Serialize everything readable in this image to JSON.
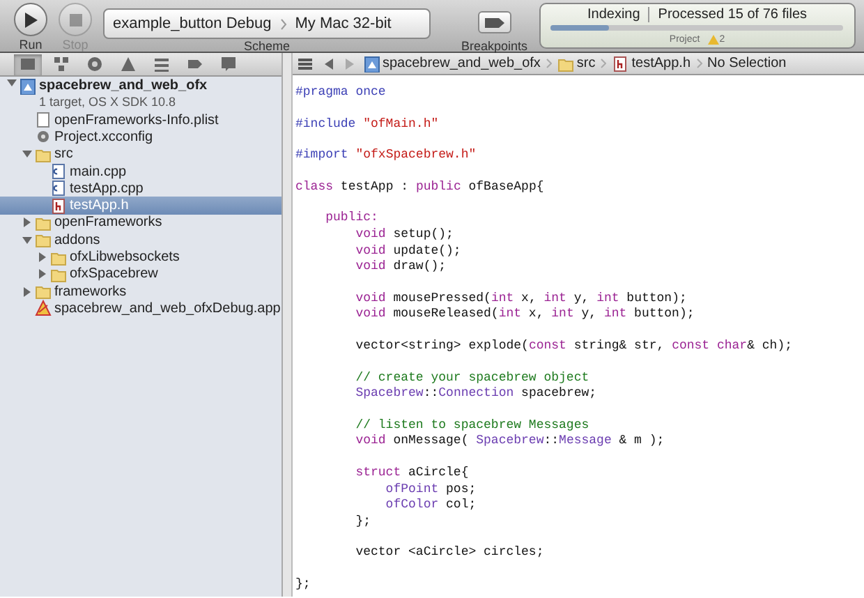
{
  "toolbar": {
    "run": {
      "label": "Run",
      "disabled": false
    },
    "stop": {
      "label": "Stop",
      "disabled": true
    },
    "scheme": {
      "target": "example_button Debug",
      "destination": "My Mac 32-bit",
      "label": "Scheme"
    },
    "breakpoints": {
      "label": "Breakpoints"
    },
    "activity": {
      "task": "Indexing",
      "status": "Processed 15 of 76 files",
      "level": 0.2,
      "scope": "Project",
      "warnings": "2"
    }
  },
  "navigator_tabs": [
    {
      "kind": "project",
      "selected": true
    },
    {
      "kind": "symbols",
      "selected": false
    },
    {
      "kind": "search",
      "selected": false
    },
    {
      "kind": "issues",
      "selected": false
    },
    {
      "kind": "debug",
      "selected": false
    },
    {
      "kind": "breakpoints",
      "selected": false
    },
    {
      "kind": "log",
      "selected": false
    }
  ],
  "jump_bar": [
    {
      "kind": "project",
      "label": "spacebrew_and_web_ofx"
    },
    {
      "kind": "folder",
      "label": "src"
    },
    {
      "kind": "header",
      "label": "testApp.h"
    },
    {
      "kind": "none",
      "label": "No Selection"
    }
  ],
  "tree": [
    {
      "kind": "project",
      "label": "spacebrew_and_web_ofx",
      "subtitle": "1 target, OS X SDK 10.8",
      "expanded": true,
      "selected": false,
      "children": [
        {
          "kind": "plist",
          "label": "openFrameworks-Info.plist",
          "selected": false
        },
        {
          "kind": "config",
          "label": "Project.xcconfig",
          "selected": false
        },
        {
          "kind": "folder",
          "label": "src",
          "expanded": true,
          "selected": false,
          "children": [
            {
              "kind": "cpp",
              "label": "main.cpp",
              "selected": false
            },
            {
              "kind": "cpp",
              "label": "testApp.cpp",
              "selected": false
            },
            {
              "kind": "header",
              "label": "testApp.h",
              "selected": true
            }
          ]
        },
        {
          "kind": "folder",
          "label": "openFrameworks",
          "expanded": false,
          "selected": false
        },
        {
          "kind": "folder",
          "label": "addons",
          "expanded": true,
          "selected": false,
          "children": [
            {
              "kind": "folder",
              "label": "ofxLibwebsockets",
              "expanded": false,
              "selected": false
            },
            {
              "kind": "folder",
              "label": "ofxSpacebrew",
              "expanded": false,
              "selected": false
            }
          ]
        },
        {
          "kind": "folder",
          "label": "frameworks",
          "expanded": false,
          "selected": false
        },
        {
          "kind": "app",
          "label": "spacebrew_and_web_ofxDebug.app",
          "selected": false
        }
      ]
    }
  ],
  "code_blocks": [
    [
      [
        {
          "kind": "pp",
          "text": "#pragma once"
        }
      ]
    ],
    [
      [
        {
          "kind": "pp",
          "text": "#include "
        },
        {
          "kind": "str",
          "text": "\"ofMain.h\""
        }
      ]
    ],
    [
      [
        {
          "kind": "pp",
          "text": "#import "
        },
        {
          "kind": "str",
          "text": "\"ofxSpacebrew.h\""
        }
      ]
    ],
    [
      [
        {
          "kind": "kw",
          "text": "class"
        },
        {
          "kind": "plain",
          "text": " testApp : "
        },
        {
          "kind": "kw",
          "text": "public"
        },
        {
          "kind": "plain",
          "text": " ofBaseApp{"
        }
      ]
    ],
    [
      [
        {
          "kind": "kw",
          "text": "    public:"
        }
      ],
      [
        {
          "kind": "kw",
          "text": "        void"
        },
        {
          "kind": "plain",
          "text": " setup();"
        }
      ],
      [
        {
          "kind": "kw",
          "text": "        void"
        },
        {
          "kind": "plain",
          "text": " update();"
        }
      ],
      [
        {
          "kind": "kw",
          "text": "        void"
        },
        {
          "kind": "plain",
          "text": " draw();"
        }
      ]
    ],
    [
      [
        {
          "kind": "kw",
          "text": "        void"
        },
        {
          "kind": "plain",
          "text": " mousePressed("
        },
        {
          "kind": "kw",
          "text": "int"
        },
        {
          "kind": "plain",
          "text": " x, "
        },
        {
          "kind": "kw",
          "text": "int"
        },
        {
          "kind": "plain",
          "text": " y, "
        },
        {
          "kind": "kw",
          "text": "int"
        },
        {
          "kind": "plain",
          "text": " button);"
        }
      ],
      [
        {
          "kind": "kw",
          "text": "        void"
        },
        {
          "kind": "plain",
          "text": " mouseReleased("
        },
        {
          "kind": "kw",
          "text": "int"
        },
        {
          "kind": "plain",
          "text": " x, "
        },
        {
          "kind": "kw",
          "text": "int"
        },
        {
          "kind": "plain",
          "text": " y, "
        },
        {
          "kind": "kw",
          "text": "int"
        },
        {
          "kind": "plain",
          "text": " button);"
        }
      ]
    ],
    [
      [
        {
          "kind": "plain",
          "text": "        vector<string> explode("
        },
        {
          "kind": "kw",
          "text": "const"
        },
        {
          "kind": "plain",
          "text": " string& str, "
        },
        {
          "kind": "kw",
          "text": "const char"
        },
        {
          "kind": "plain",
          "text": "& ch);"
        }
      ]
    ],
    [
      [
        {
          "kind": "cmt",
          "text": "        // create your spacebrew object"
        }
      ],
      [
        {
          "kind": "type",
          "text": "        Spacebrew"
        },
        {
          "kind": "plain",
          "text": "::"
        },
        {
          "kind": "type",
          "text": "Connection"
        },
        {
          "kind": "plain",
          "text": " spacebrew;"
        }
      ]
    ],
    [
      [
        {
          "kind": "cmt",
          "text": "        // listen to spacebrew Messages"
        }
      ],
      [
        {
          "kind": "kw",
          "text": "        void"
        },
        {
          "kind": "plain",
          "text": " onMessage( "
        },
        {
          "kind": "type",
          "text": "Spacebrew"
        },
        {
          "kind": "plain",
          "text": "::"
        },
        {
          "kind": "type",
          "text": "Message"
        },
        {
          "kind": "plain",
          "text": " & m );"
        }
      ]
    ],
    [
      [
        {
          "kind": "kw",
          "text": "        struct"
        },
        {
          "kind": "plain",
          "text": " aCircle{"
        }
      ],
      [
        {
          "kind": "type",
          "text": "            ofPoint"
        },
        {
          "kind": "plain",
          "text": " pos;"
        }
      ],
      [
        {
          "kind": "type",
          "text": "            ofColor"
        },
        {
          "kind": "plain",
          "text": " col;"
        }
      ],
      [
        {
          "kind": "plain",
          "text": "        };"
        }
      ]
    ],
    [
      [
        {
          "kind": "plain",
          "text": "        vector <aCircle> circles;"
        }
      ]
    ],
    [
      [
        {
          "kind": "plain",
          "text": "};"
        }
      ]
    ]
  ]
}
